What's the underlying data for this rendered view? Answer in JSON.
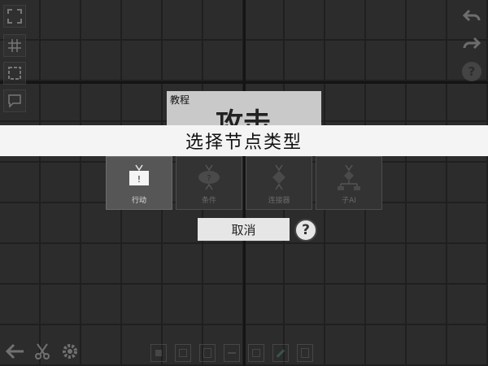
{
  "tutorial": {
    "title": "教程",
    "body": "攻击"
  },
  "dialog": {
    "title": "选择节点类型",
    "node_types": [
      {
        "label": "行动",
        "icon": "action-node-icon",
        "selected": true
      },
      {
        "label": "条件",
        "icon": "condition-node-icon",
        "selected": false
      },
      {
        "label": "连接器",
        "icon": "connector-node-icon",
        "selected": false
      },
      {
        "label": "子AI",
        "icon": "sub-ai-node-icon",
        "selected": false
      }
    ],
    "cancel_label": "取消",
    "help_label": "?"
  },
  "toolbar_right": {
    "help_label": "?"
  },
  "colors": {
    "banner_bg": "#f4f4f4",
    "grid_bg": "#2c2c2c",
    "selected_tile": "#565656"
  }
}
